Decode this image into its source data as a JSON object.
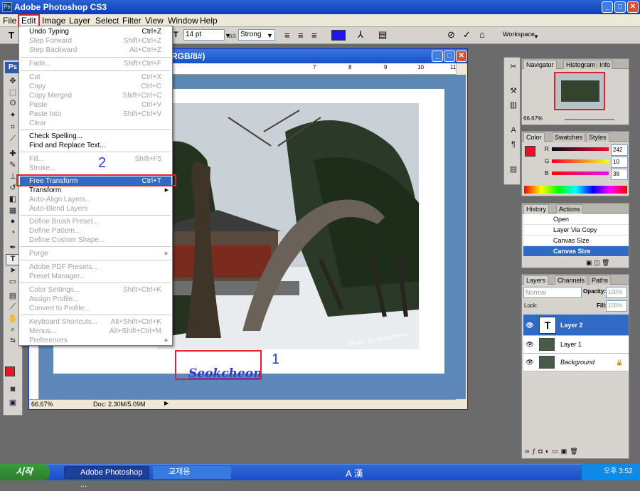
{
  "app": {
    "title": "Adobe Photoshop CS3"
  },
  "menubar": [
    "File",
    "Edit",
    "Image",
    "Layer",
    "Select",
    "Filter",
    "View",
    "Window",
    "Help"
  ],
  "options": {
    "font_size": "14 pt",
    "aa_label": "aa",
    "aa_value": "Strong",
    "color": "#2014f0",
    "workspace": "Workspace"
  },
  "toolbox": {
    "logo": "Ps",
    "foreground": "#e8142a"
  },
  "doc": {
    "title_fragment": "RGB/8#)",
    "zoom": "66.67%",
    "doc_size": "Doc: 2.30M/5.09M",
    "ruler_numbers": [
      "7",
      "8",
      "9",
      "10",
      "11"
    ]
  },
  "edit_menu": {
    "items": [
      {
        "label": "Undo Typing",
        "shortcut": "Ctrl+Z",
        "disabled": false
      },
      {
        "label": "Step Forward",
        "shortcut": "Shift+Ctrl+Z",
        "disabled": true
      },
      {
        "label": "Step Backward",
        "shortcut": "Alt+Ctrl+Z",
        "disabled": true
      },
      {
        "label": "Fade...",
        "shortcut": "Shift+Ctrl+F",
        "disabled": true
      },
      {
        "label": "Cut",
        "shortcut": "Ctrl+X",
        "disabled": true
      },
      {
        "label": "Copy",
        "shortcut": "Ctrl+C",
        "disabled": true
      },
      {
        "label": "Copy Merged",
        "shortcut": "Shift+Ctrl+C",
        "disabled": true
      },
      {
        "label": "Paste",
        "shortcut": "Ctrl+V",
        "disabled": true
      },
      {
        "label": "Paste Into",
        "shortcut": "Shift+Ctrl+V",
        "disabled": true
      },
      {
        "label": "Clear",
        "shortcut": "",
        "disabled": true
      },
      {
        "label": "Check Spelling...",
        "shortcut": "",
        "disabled": false
      },
      {
        "label": "Find and Replace Text...",
        "shortcut": "",
        "disabled": false
      },
      {
        "label": "Fill...",
        "shortcut": "Shift+F5",
        "disabled": true
      },
      {
        "label": "Stroke...",
        "shortcut": "",
        "disabled": true
      },
      {
        "label": "Free Transform",
        "shortcut": "Ctrl+T",
        "disabled": false
      },
      {
        "label": "Transform",
        "shortcut": "",
        "disabled": false
      },
      {
        "label": "Auto-Align Layers...",
        "shortcut": "",
        "disabled": true
      },
      {
        "label": "Auto-Blend Layers",
        "shortcut": "",
        "disabled": true
      },
      {
        "label": "Define Brush Preset...",
        "shortcut": "",
        "disabled": true
      },
      {
        "label": "Define Pattern...",
        "shortcut": "",
        "disabled": true
      },
      {
        "label": "Define Custom Shape...",
        "shortcut": "",
        "disabled": true
      },
      {
        "label": "Purge",
        "shortcut": "",
        "disabled": true
      },
      {
        "label": "Adobe PDF Presets...",
        "shortcut": "",
        "disabled": true
      },
      {
        "label": "Preset Manager...",
        "shortcut": "",
        "disabled": true
      },
      {
        "label": "Color Settings...",
        "shortcut": "Shift+Ctrl+K",
        "disabled": true
      },
      {
        "label": "Assign Profile...",
        "shortcut": "",
        "disabled": true
      },
      {
        "label": "Convert to Profile...",
        "shortcut": "",
        "disabled": true
      },
      {
        "label": "Keyboard Shortcuts...",
        "shortcut": "Alt+Shift+Ctrl+K",
        "disabled": true
      },
      {
        "label": "Menus...",
        "shortcut": "Alt+Shift+Ctrl+M",
        "disabled": true
      },
      {
        "label": "Preferences",
        "shortcut": "",
        "disabled": true
      }
    ]
  },
  "annotations": {
    "one": "1",
    "two": "2"
  },
  "canvas_text": {
    "signature": "Seokcheon",
    "watermark": "Photo By Seokcheon"
  },
  "navigator": {
    "tabs": [
      "Navigator",
      "Histogram",
      "Info"
    ],
    "zoom": "66.67%"
  },
  "color_panel": {
    "tabs": [
      "Color",
      "Swatches",
      "Styles"
    ],
    "r": "242",
    "g": "10",
    "b": "38",
    "r_label": "R",
    "g_label": "G",
    "b_label": "B"
  },
  "history": {
    "tabs": [
      "History",
      "Actions"
    ],
    "items": [
      "Open",
      "Layer Via Copy",
      "Canvas Size",
      "Canvas Size"
    ]
  },
  "layers": {
    "tabs": [
      "Layers",
      "Channels",
      "Paths"
    ],
    "blend": "Normal",
    "opacity_label": "Opacity:",
    "opacity": "100%",
    "lock_label": "Lock:",
    "fill_label": "Fill:",
    "fill": "100%",
    "items": [
      "Layer 2",
      "Layer 1",
      "Background"
    ]
  },
  "taskbar": {
    "start": "시작",
    "items": [
      "Adobe Photoshop ...",
      "교재용"
    ],
    "clock": "오후 3:52",
    "ime": "A 漢"
  }
}
